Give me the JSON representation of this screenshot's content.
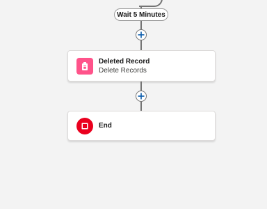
{
  "flow": {
    "wait_element": {
      "label": "Wait 5 Minutes"
    },
    "nodes": [
      {
        "title": "Deleted Record",
        "subtitle": "Delete Records",
        "icon": "delete-records-icon",
        "color": "#ff538a"
      },
      {
        "title": "End",
        "icon": "stop-icon",
        "color": "#ea001e"
      }
    ],
    "add_element_icon": "plus-icon",
    "colors": {
      "connector": "#747474",
      "canvas": "#f3f3f3",
      "plus": "#0b5cab"
    }
  }
}
